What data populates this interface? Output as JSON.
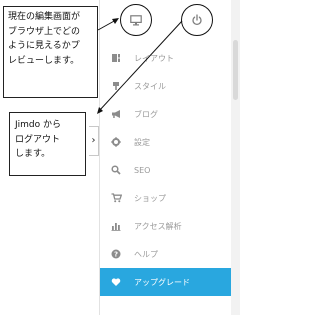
{
  "callouts": {
    "preview": {
      "lines": [
        "現在の編集画面が",
        "ブラウザ上でどの",
        "ように見えるかプ",
        "レビューします。"
      ]
    },
    "logout": {
      "lines": [
        "Jimdo から",
        "ログアウト",
        "します。"
      ]
    }
  },
  "sidebar": {
    "collapse_icon": "chevron-right-icon",
    "items": [
      {
        "label": "レイアウト",
        "icon": "layout-icon"
      },
      {
        "label": "スタイル",
        "icon": "brush-icon"
      },
      {
        "label": "ブログ",
        "icon": "megaphone-icon"
      },
      {
        "label": "設定",
        "icon": "gear-icon"
      },
      {
        "label": "SEO",
        "icon": "search-icon"
      },
      {
        "label": "ショップ",
        "icon": "cart-icon"
      },
      {
        "label": "アクセス解析",
        "icon": "bar-chart-icon"
      },
      {
        "label": "ヘルプ",
        "icon": "question-icon"
      },
      {
        "label": "アップグレード",
        "icon": "heart-icon",
        "active": true
      }
    ]
  },
  "top_icons": {
    "preview": "monitor-icon",
    "logout": "power-icon"
  },
  "colors": {
    "accent": "#29a7df",
    "icon": "#8c8c8c",
    "text_muted": "#9a9a9a"
  }
}
